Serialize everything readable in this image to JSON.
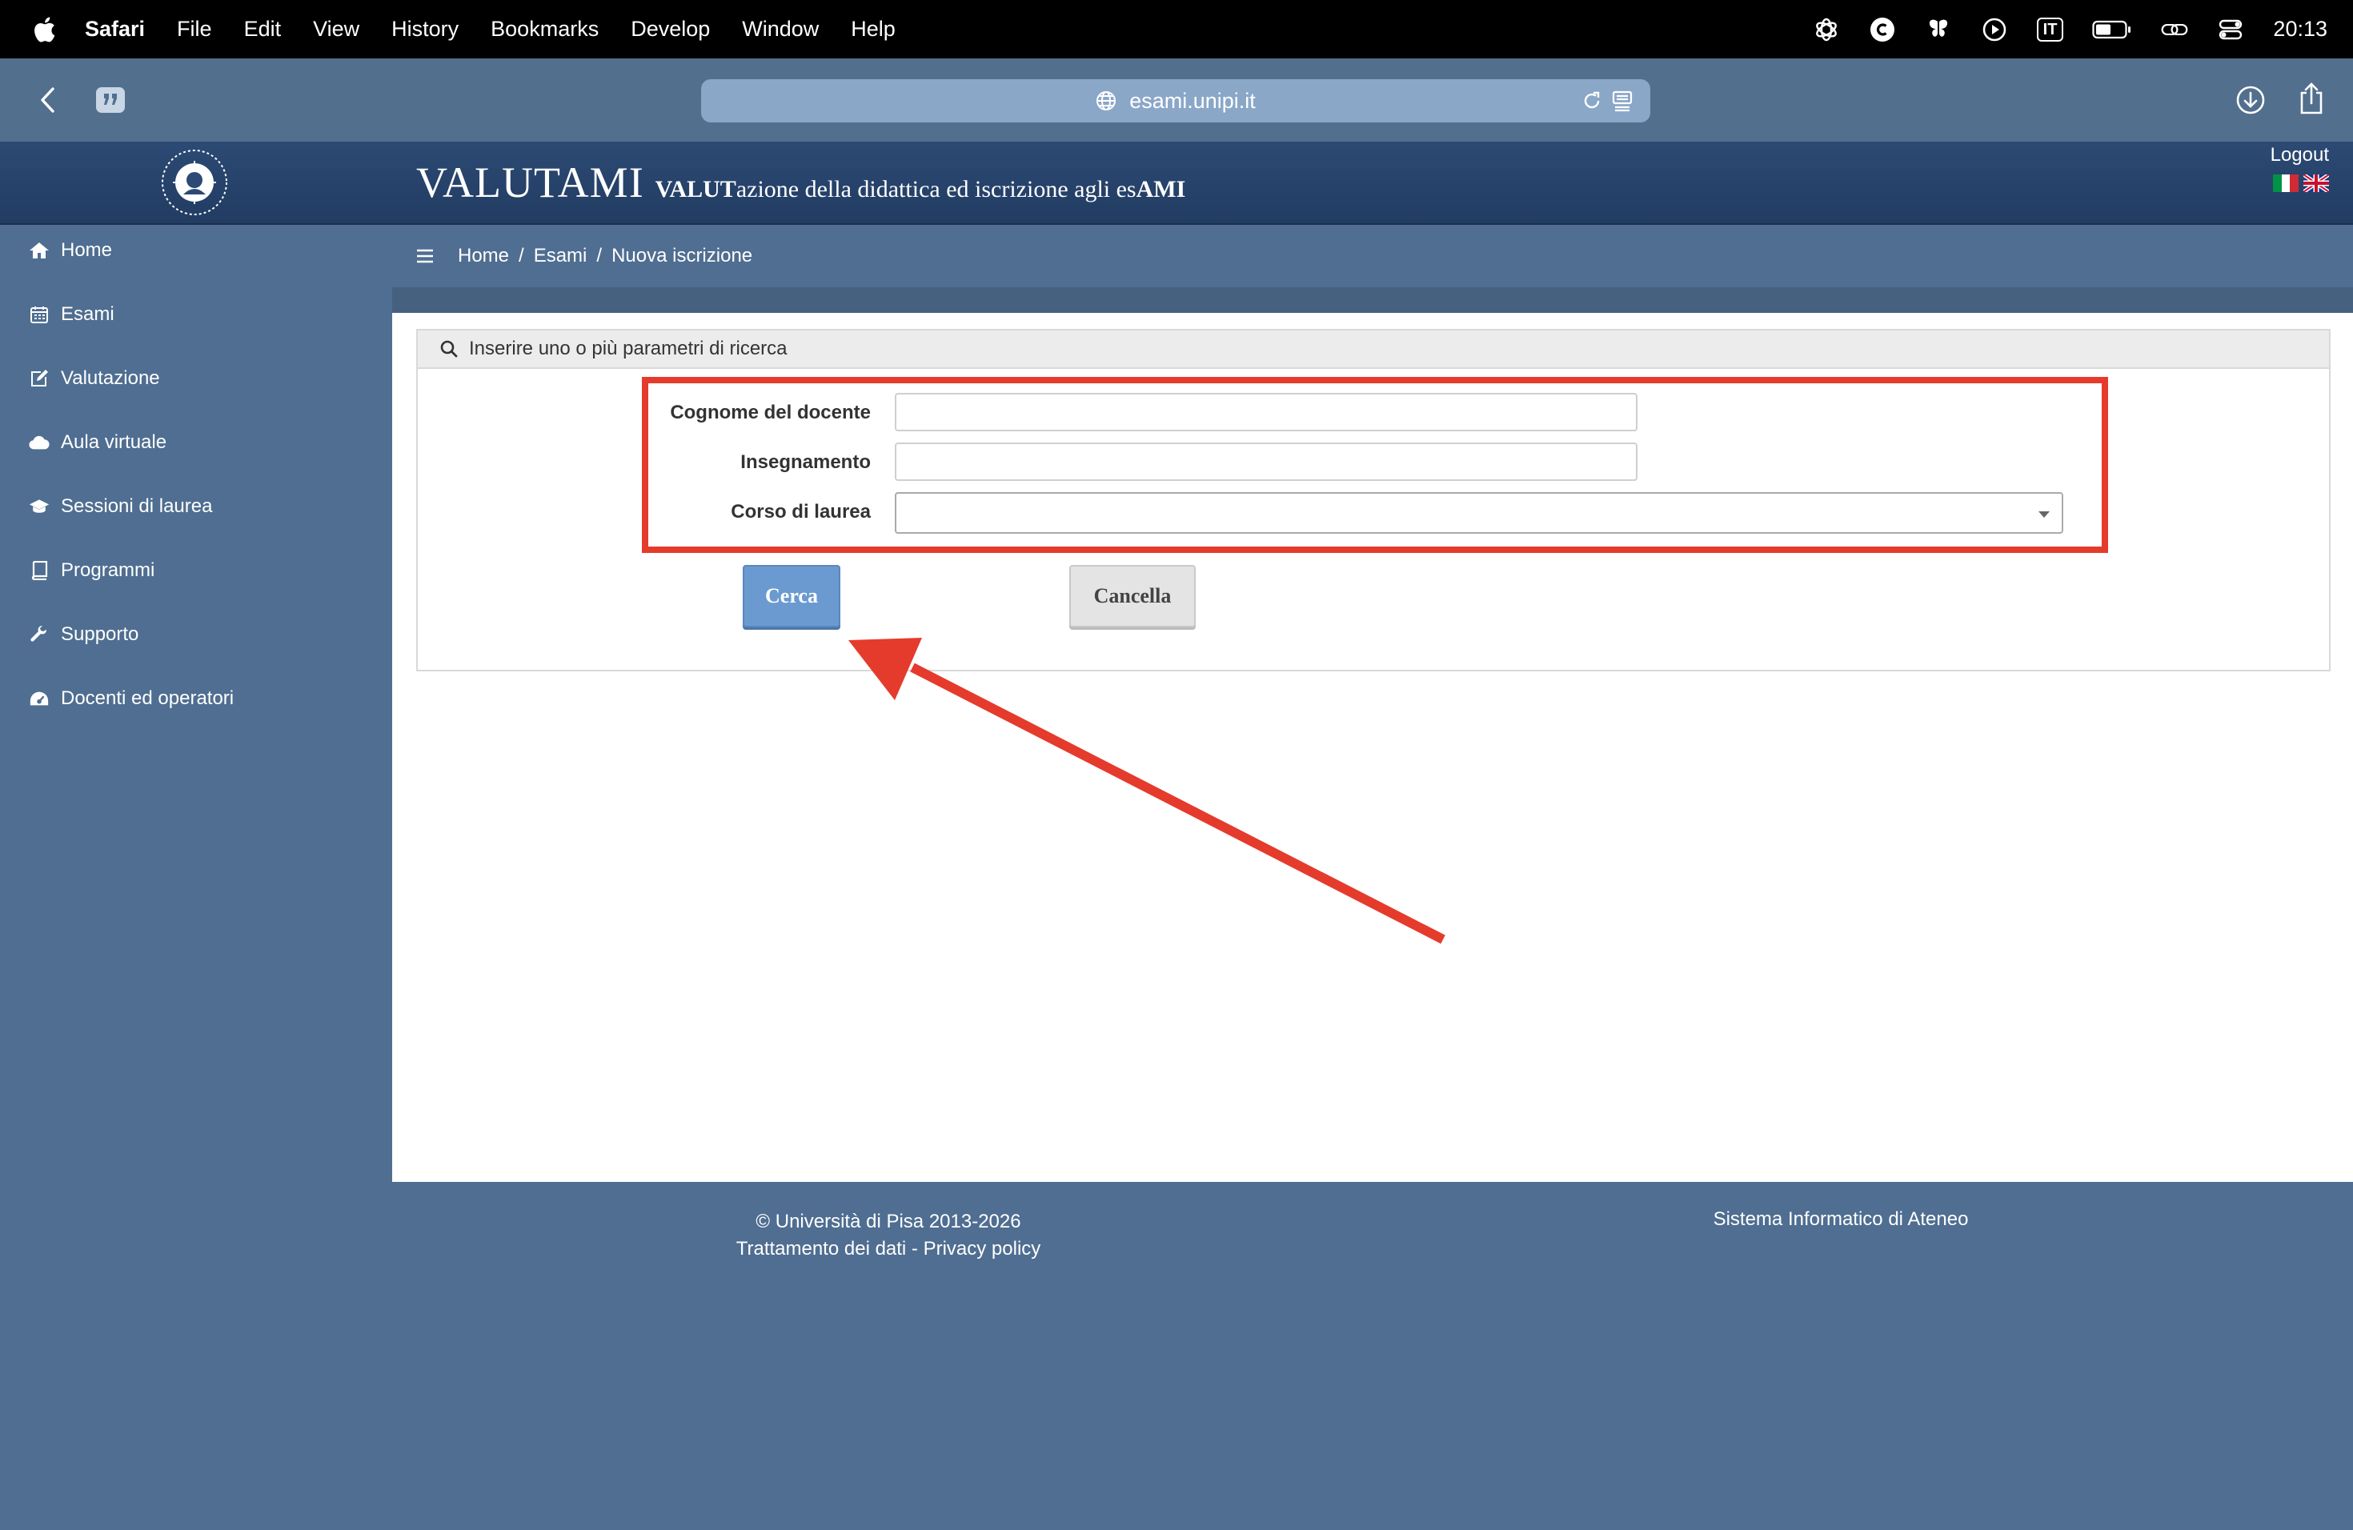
{
  "menubar": {
    "app": "Safari",
    "items": [
      "File",
      "Edit",
      "View",
      "History",
      "Bookmarks",
      "Develop",
      "Window",
      "Help"
    ],
    "input_source": "IT",
    "clock": "20:13"
  },
  "browser": {
    "url": "esami.unipi.it"
  },
  "header": {
    "title_big": "VALUTAMI",
    "tag_bold1": "VALUT",
    "tag_normal1": "azione della didattica ed iscrizione agli es",
    "tag_bold2": "AMI",
    "logout": "Logout"
  },
  "sidebar": {
    "items": [
      {
        "label": "Home",
        "icon": "home-icon"
      },
      {
        "label": "Esami",
        "icon": "calendar-icon"
      },
      {
        "label": "Valutazione",
        "icon": "edit-icon"
      },
      {
        "label": "Aula virtuale",
        "icon": "cloud-icon"
      },
      {
        "label": "Sessioni di laurea",
        "icon": "graduation-cap-icon"
      },
      {
        "label": "Programmi",
        "icon": "book-icon"
      },
      {
        "label": "Supporto",
        "icon": "wrench-icon"
      },
      {
        "label": "Docenti ed operatori",
        "icon": "dashboard-icon"
      }
    ]
  },
  "breadcrumb": {
    "items": [
      "Home",
      "Esami",
      "Nuova iscrizione"
    ],
    "separator": "/"
  },
  "search": {
    "panel_title": "Inserire uno o più parametri di ricerca",
    "fields": [
      {
        "label": "Cognome del docente",
        "value": ""
      },
      {
        "label": "Insegnamento",
        "value": ""
      },
      {
        "label": "Corso di laurea",
        "value": ""
      }
    ],
    "search_button": "Cerca",
    "cancel_button": "Cancella"
  },
  "footer": {
    "copyright": "© Università di Pisa 2013-2026",
    "privacy": "Trattamento dei dati - Privacy policy",
    "system": "Sistema Informatico di Ateneo"
  },
  "colors": {
    "annotation": "#e53b2c",
    "header_bg": "#2c4a74",
    "sidebar_bg": "#4f6e91",
    "primary_button": "#6a9ad0"
  }
}
